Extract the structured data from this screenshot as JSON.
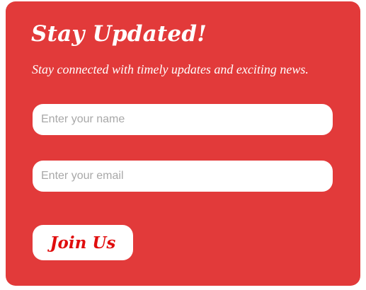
{
  "colors": {
    "card_background": "#e23a3a",
    "text_on_card": "#ffffff",
    "button_text": "#e00d0d",
    "field_background": "#ffffff",
    "placeholder": "#a8a8a8"
  },
  "signup": {
    "title": "Stay Updated!",
    "subtitle": "Stay connected with timely updates and exciting news.",
    "name_field": {
      "value": "",
      "placeholder": "Enter your name"
    },
    "email_field": {
      "value": "",
      "placeholder": "Enter your email"
    },
    "submit_label": "Join Us"
  }
}
